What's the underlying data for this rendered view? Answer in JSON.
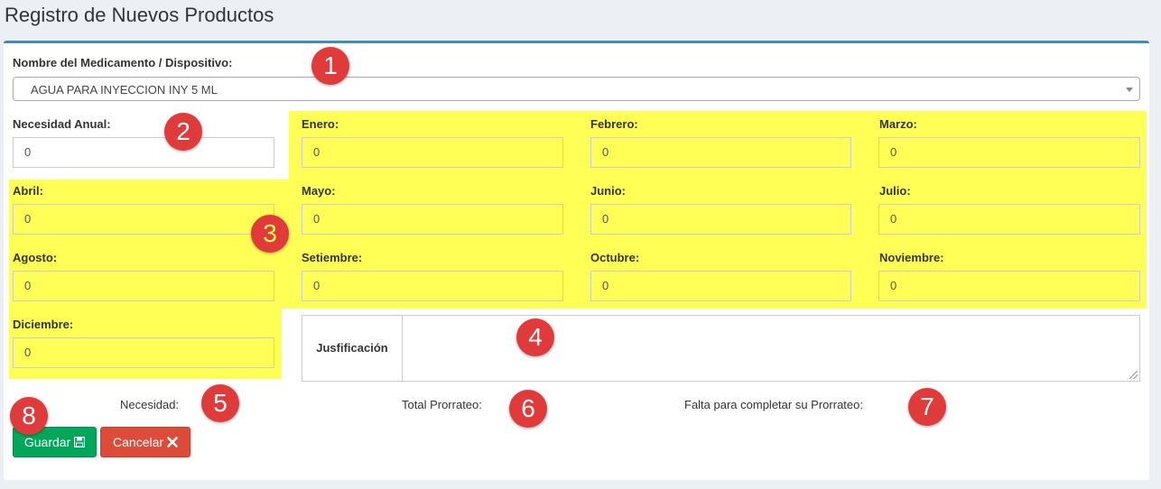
{
  "page": {
    "title": "Registro de Nuevos Productos"
  },
  "product": {
    "label": "Nombre del Medicamento / Dispositivo:",
    "selected": "AGUA PARA INYECCION INY 5 ML"
  },
  "annual": {
    "label": "Necesidad Anual:",
    "value": "0"
  },
  "months": [
    {
      "label": "Enero:",
      "value": "0"
    },
    {
      "label": "Febrero:",
      "value": "0"
    },
    {
      "label": "Marzo:",
      "value": "0"
    },
    {
      "label": "Abril:",
      "value": "0"
    },
    {
      "label": "Mayo:",
      "value": "0"
    },
    {
      "label": "Junio:",
      "value": "0"
    },
    {
      "label": "Julio:",
      "value": "0"
    },
    {
      "label": "Agosto:",
      "value": "0"
    },
    {
      "label": "Setiembre:",
      "value": "0"
    },
    {
      "label": "Octubre:",
      "value": "0"
    },
    {
      "label": "Noviembre:",
      "value": "0"
    },
    {
      "label": "Diciembre:",
      "value": "0"
    }
  ],
  "justification": {
    "label": "Jusfificación",
    "value": ""
  },
  "summary": {
    "need_label": "Necesidad:",
    "total_label": "Total Prorrateo:",
    "missing_label": "Falta para completar su Prorrateo:"
  },
  "buttons": {
    "save": "Guardar",
    "cancel": "Cancelar"
  },
  "markers": [
    "1",
    "2",
    "3",
    "4",
    "5",
    "6",
    "7",
    "8"
  ],
  "colors": {
    "highlight": "#ffff55",
    "marker": "#e03a3a",
    "save": "#00a65a",
    "cancel": "#dd4b39",
    "box_border": "#3c8dbc"
  }
}
